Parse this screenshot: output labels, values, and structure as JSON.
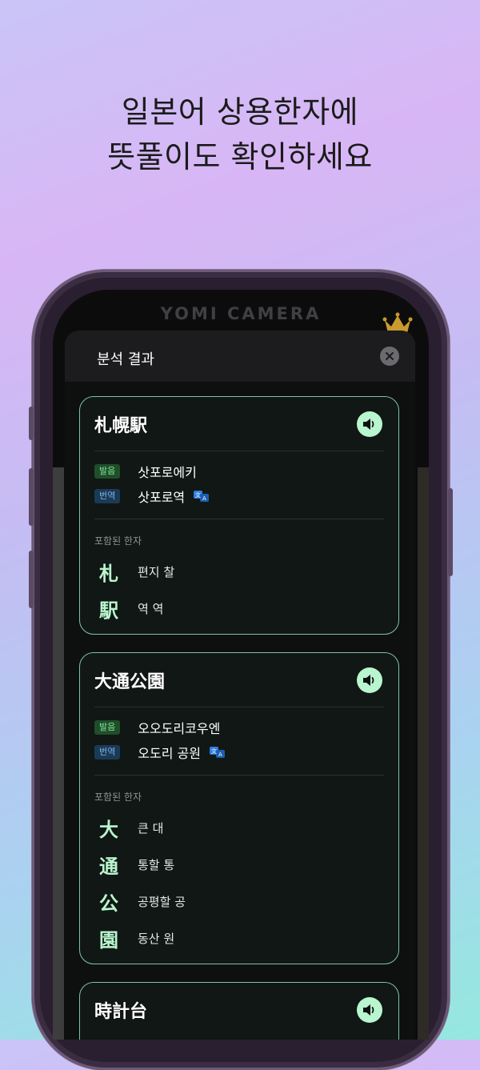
{
  "headline": {
    "line1": "일본어 상용한자에",
    "line2": "뜻풀이도 확인하세요"
  },
  "app": {
    "title": "YOMI CAMERA",
    "premium_icon": "crown-icon"
  },
  "sheet": {
    "title": "분석 결과",
    "close_icon": "close-icon"
  },
  "labels": {
    "pronunciation": "발음",
    "translation": "번역",
    "included_kanji": "포함된 한자"
  },
  "results": [
    {
      "word": "札幌駅",
      "pronunciation": "삿포로에키",
      "translation": "삿포로역",
      "kanji": [
        {
          "char": "札",
          "meaning": "편지 찰"
        },
        {
          "char": "駅",
          "meaning": "역 역"
        }
      ]
    },
    {
      "word": "大通公園",
      "pronunciation": "오오도리코우엔",
      "translation": "오도리 공원",
      "kanji": [
        {
          "char": "大",
          "meaning": "큰 대"
        },
        {
          "char": "通",
          "meaning": "통할 통"
        },
        {
          "char": "公",
          "meaning": "공평할 공"
        },
        {
          "char": "園",
          "meaning": "동산 원"
        }
      ]
    },
    {
      "word": "時計台"
    }
  ],
  "colors": {
    "accent": "#b9f5cf",
    "card_border": "#7fc4a2",
    "tag_green": "#7fe39a",
    "tag_blue": "#79b4ec"
  }
}
